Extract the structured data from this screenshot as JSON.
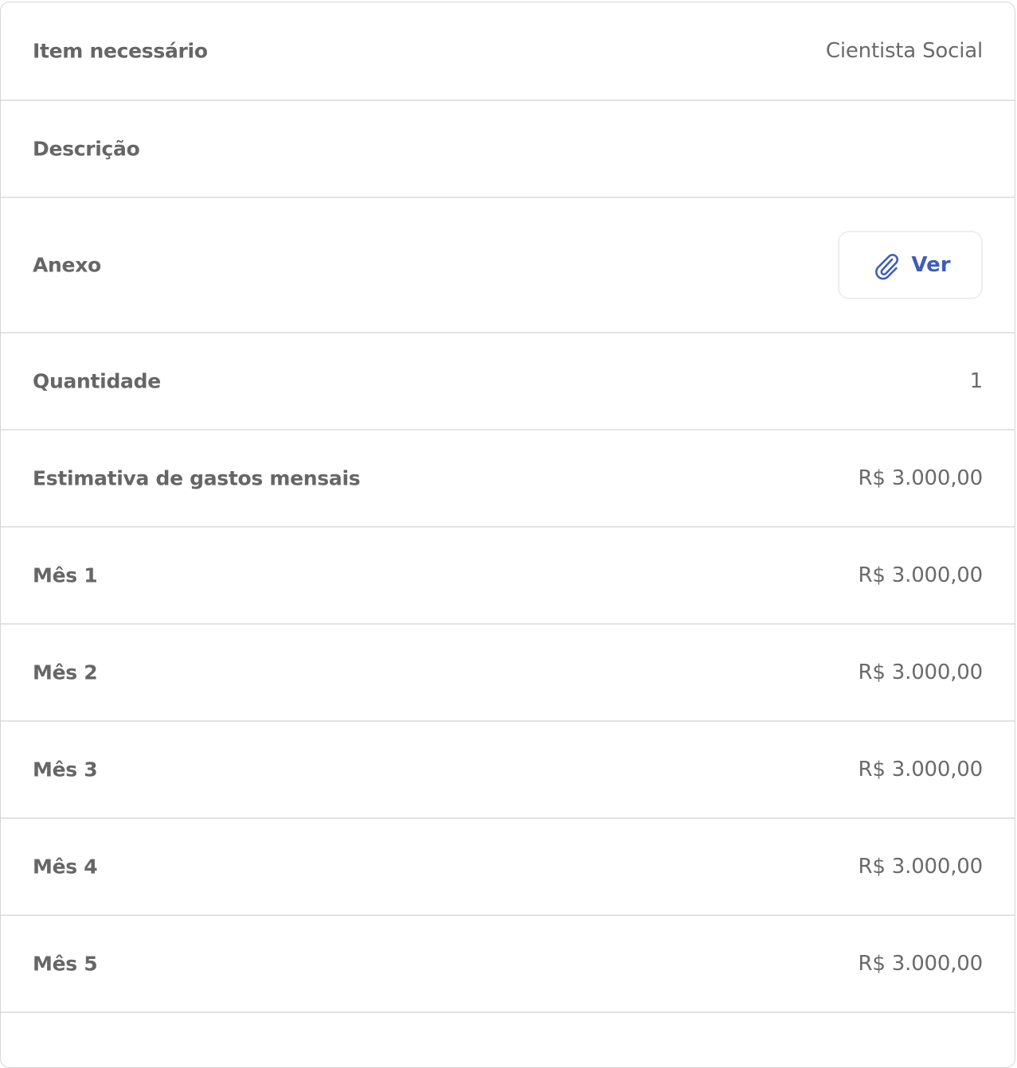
{
  "rows": [
    {
      "label": "Item necessário",
      "value": "Cientista Social"
    },
    {
      "label": "Descrição",
      "value": ""
    },
    {
      "label": "Anexo",
      "button_label": "Ver",
      "icon": "paperclip-icon"
    },
    {
      "label": "Quantidade",
      "value": "1"
    },
    {
      "label": "Estimativa de gastos mensais",
      "value": "R$ 3.000,00"
    },
    {
      "label": "Mês 1",
      "value": "R$ 3.000,00"
    },
    {
      "label": "Mês 2",
      "value": "R$ 3.000,00"
    },
    {
      "label": "Mês 3",
      "value": "R$ 3.000,00"
    },
    {
      "label": "Mês 4",
      "value": "R$ 3.000,00"
    },
    {
      "label": "Mês 5",
      "value": "R$ 3.000,00"
    }
  ],
  "colors": {
    "label": "#666666",
    "value": "#6a6a6a",
    "accent": "#3f5db8",
    "divider": "#e3e3e3"
  }
}
